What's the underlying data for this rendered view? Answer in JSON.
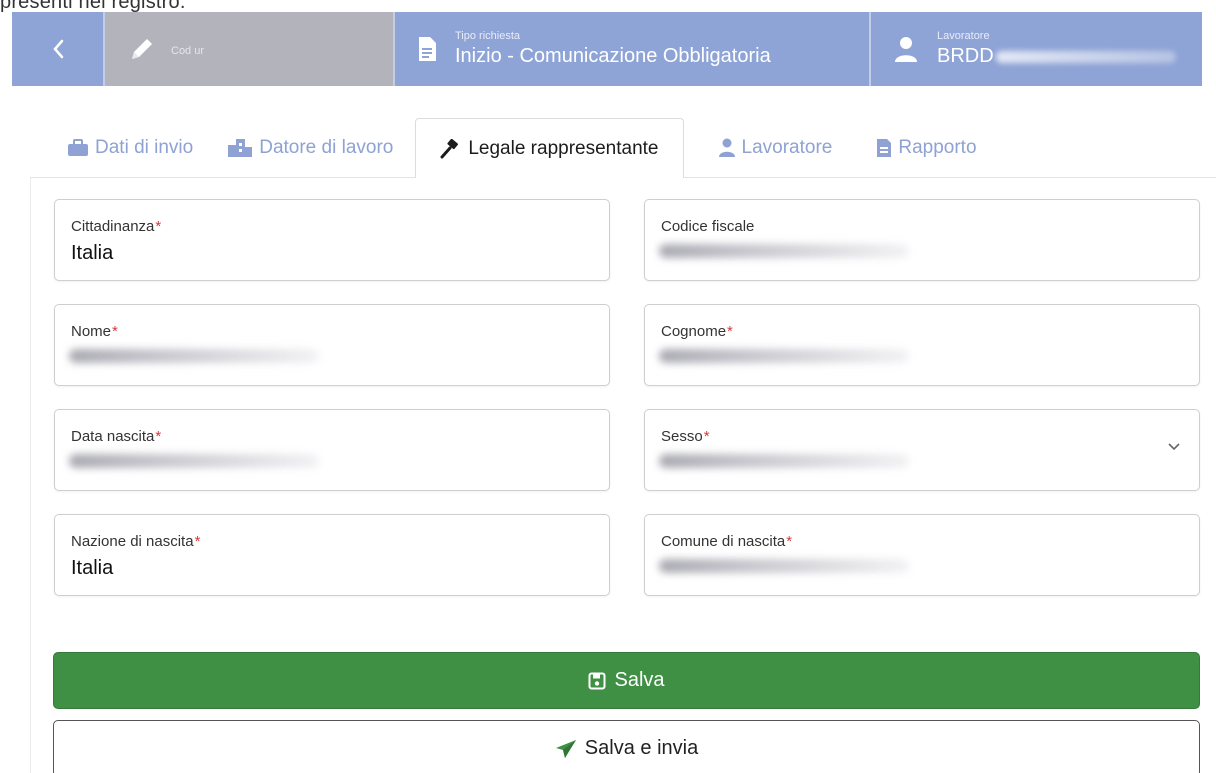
{
  "top_text": "presenti nel registro.",
  "header": {
    "back_icon": "chevron-left-icon",
    "cod": {
      "icon": "pencil-icon",
      "label": "Cod ur"
    },
    "tipo": {
      "icon": "document-icon",
      "label": "Tipo richiesta",
      "value": "Inizio - Comunicazione Obbligatoria"
    },
    "lavoratore": {
      "icon": "user-icon",
      "label": "Lavoratore",
      "value": "BRDD"
    }
  },
  "tabs": [
    {
      "label": "Dati di invio",
      "icon": "briefcase-icon"
    },
    {
      "label": "Datore di lavoro",
      "icon": "building-icon"
    },
    {
      "label": "Legale rappresentante",
      "icon": "gavel-icon",
      "active": true
    },
    {
      "label": "Lavoratore",
      "icon": "user-icon"
    },
    {
      "label": "Rapporto",
      "icon": "document-icon"
    }
  ],
  "fields": {
    "cittadinanza": {
      "label": "Cittadinanza",
      "required": "*",
      "value": "Italia"
    },
    "codice_fiscale": {
      "label": "Codice fiscale",
      "required": ""
    },
    "nome": {
      "label": "Nome",
      "required": "*"
    },
    "cognome": {
      "label": "Cognome",
      "required": "*"
    },
    "data_nascita": {
      "label": "Data nascita",
      "required": "*"
    },
    "sesso": {
      "label": "Sesso",
      "required": "*"
    },
    "nazione_nascita": {
      "label": "Nazione di nascita",
      "required": "*",
      "value": "Italia"
    },
    "comune_nascita": {
      "label": "Comune di nascita",
      "required": "*"
    }
  },
  "buttons": {
    "save_label": "Salva",
    "save_send_label": "Salva e invia"
  },
  "colors": {
    "header_blue": "#8fa4d6",
    "header_grey": "#b3b3bc",
    "tab_inactive": "#8fa2d3",
    "save_green": "#3f8f45",
    "required_red": "#d23b3b"
  }
}
